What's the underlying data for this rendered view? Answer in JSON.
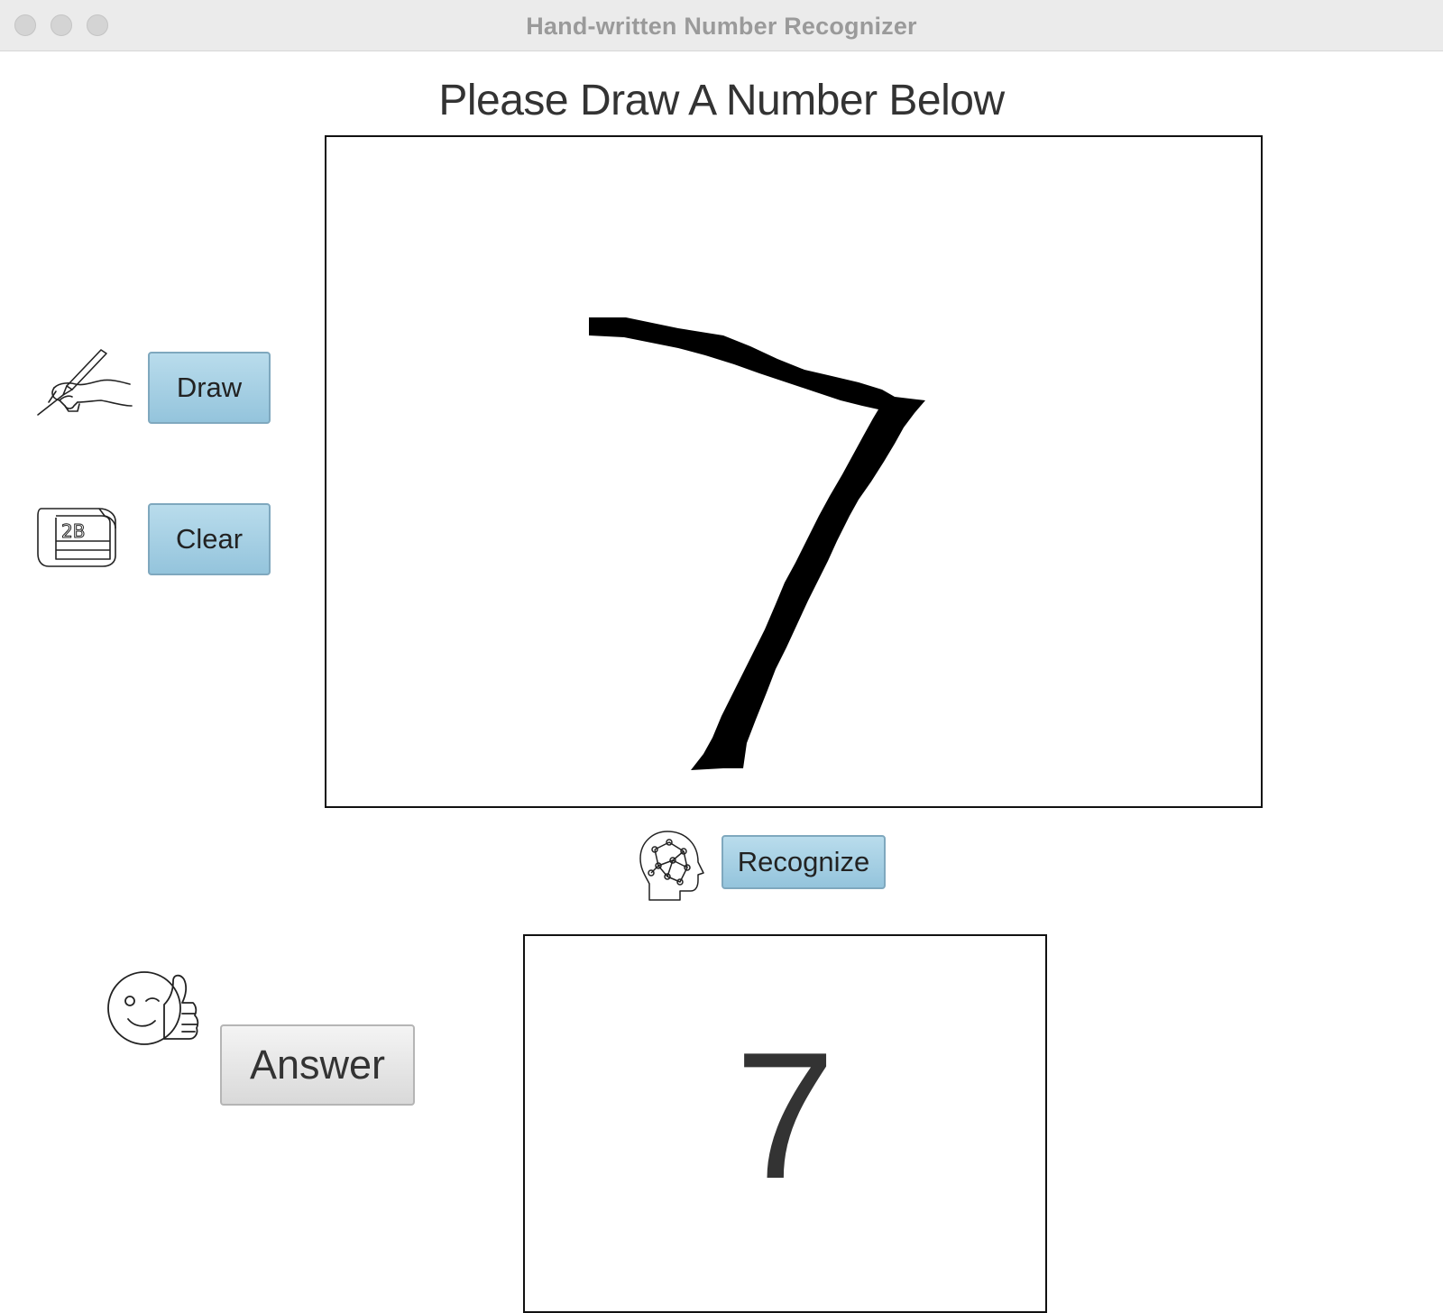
{
  "window": {
    "title": "Hand-written Number Recognizer"
  },
  "heading": "Please Draw A Number Below",
  "controls": {
    "draw_label": "Draw",
    "clear_label": "Clear",
    "recognize_label": "Recognize",
    "answer_label": "Answer"
  },
  "icons": {
    "draw": "pencil-hand-icon",
    "clear": "eraser-icon",
    "recognize": "brain-head-icon",
    "answer": "thumbs-up-face-icon"
  },
  "result": {
    "digit": "7"
  },
  "colors": {
    "button_blue": "#a5d0e4",
    "button_grey": "#e6e6e6",
    "text": "#333333",
    "stroke": "#000000"
  }
}
